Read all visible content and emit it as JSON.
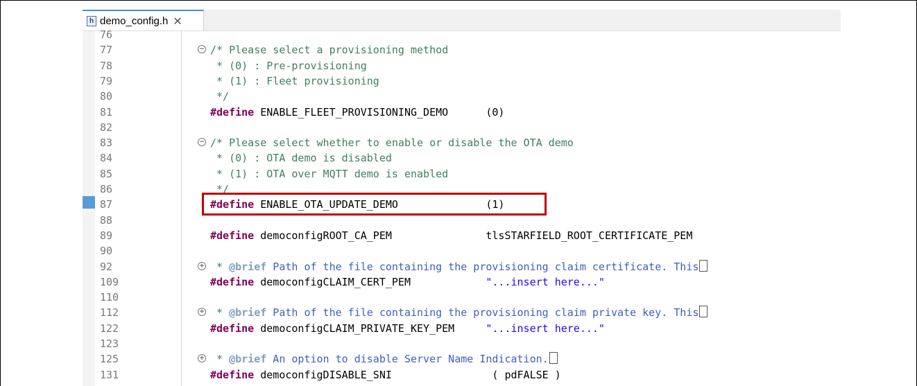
{
  "tab": {
    "icon": "header-file-icon",
    "icon_letter": "h",
    "title": "demo_config.h",
    "close_glyph": "✕"
  },
  "lines": [
    {
      "num": "76",
      "code": []
    },
    {
      "num": "77",
      "fold": "collapse",
      "code": [
        {
          "t": "/* Please select a provisioning method",
          "c": "cmt"
        }
      ]
    },
    {
      "num": "78",
      "code": [
        {
          "t": " * (0) : Pre-provisioning",
          "c": "cmt"
        }
      ]
    },
    {
      "num": "79",
      "code": [
        {
          "t": " * (1) : Fleet provisioning",
          "c": "cmt"
        }
      ]
    },
    {
      "num": "80",
      "code": [
        {
          "t": " */",
          "c": "cmt"
        }
      ]
    },
    {
      "num": "81",
      "code": [
        {
          "t": "#define",
          "c": "kw"
        },
        {
          "t": " ENABLE_FLEET_PROVISIONING_DEMO      (0)",
          "c": ""
        }
      ]
    },
    {
      "num": "82",
      "code": []
    },
    {
      "num": "83",
      "fold": "collapse",
      "code": [
        {
          "t": "/* Please select whether to enable or disable the OTA demo",
          "c": "cmt"
        }
      ]
    },
    {
      "num": "84",
      "code": [
        {
          "t": " * (0) : OTA demo is disabled",
          "c": "cmt"
        }
      ]
    },
    {
      "num": "85",
      "code": [
        {
          "t": " * (1) : OTA over MQTT demo is enabled",
          "c": "cmt"
        }
      ]
    },
    {
      "num": "86",
      "code": [
        {
          "t": " */",
          "c": "cmt"
        }
      ]
    },
    {
      "num": "87",
      "code": [
        {
          "t": "#define",
          "c": "kw"
        },
        {
          "t": " ENABLE_OTA_UPDATE_DEMO              (1)",
          "c": ""
        }
      ]
    },
    {
      "num": "88",
      "code": []
    },
    {
      "num": "89",
      "code": [
        {
          "t": "#define",
          "c": "kw"
        },
        {
          "t": " democonfigROOT_CA_PEM               tlsSTARFIELD_ROOT_CERTIFICATE_PEM",
          "c": ""
        }
      ]
    },
    {
      "num": "90",
      "code": []
    },
    {
      "num": "92",
      "fold": "expand",
      "code": [
        {
          "t": " * ",
          "c": "cmt"
        },
        {
          "t": "@brief",
          "c": "tag"
        },
        {
          "t": " Path of the file containing the provisioning claim certificate. This",
          "c": "doc"
        },
        {
          "t": "",
          "c": "cont"
        }
      ]
    },
    {
      "num": "109",
      "code": [
        {
          "t": "#define",
          "c": "kw"
        },
        {
          "t": " democonfigCLAIM_CERT_PEM            ",
          "c": ""
        },
        {
          "t": "\"...insert here...\"",
          "c": "str"
        }
      ]
    },
    {
      "num": "110",
      "code": []
    },
    {
      "num": "112",
      "fold": "expand",
      "code": [
        {
          "t": " * ",
          "c": "cmt"
        },
        {
          "t": "@brief",
          "c": "tag"
        },
        {
          "t": " Path of the file containing the provisioning claim private key. This",
          "c": "doc"
        },
        {
          "t": "",
          "c": "cont"
        }
      ]
    },
    {
      "num": "122",
      "code": [
        {
          "t": "#define",
          "c": "kw"
        },
        {
          "t": " democonfigCLAIM_PRIVATE_KEY_PEM     ",
          "c": ""
        },
        {
          "t": "\"...insert here...\"",
          "c": "str"
        }
      ]
    },
    {
      "num": "123",
      "code": []
    },
    {
      "num": "125",
      "fold": "expand",
      "code": [
        {
          "t": " * ",
          "c": "cmt"
        },
        {
          "t": "@brief",
          "c": "tag"
        },
        {
          "t": " An option to disable Server Name Indication.",
          "c": "doc"
        },
        {
          "t": "",
          "c": "cont"
        }
      ]
    },
    {
      "num": "131",
      "code": [
        {
          "t": "#define",
          "c": "kw"
        },
        {
          "t": " democonfigDISABLE_SNI                ( pdFALSE )",
          "c": ""
        }
      ]
    }
  ],
  "highlight": {
    "line": "87",
    "color": "#c00000"
  }
}
